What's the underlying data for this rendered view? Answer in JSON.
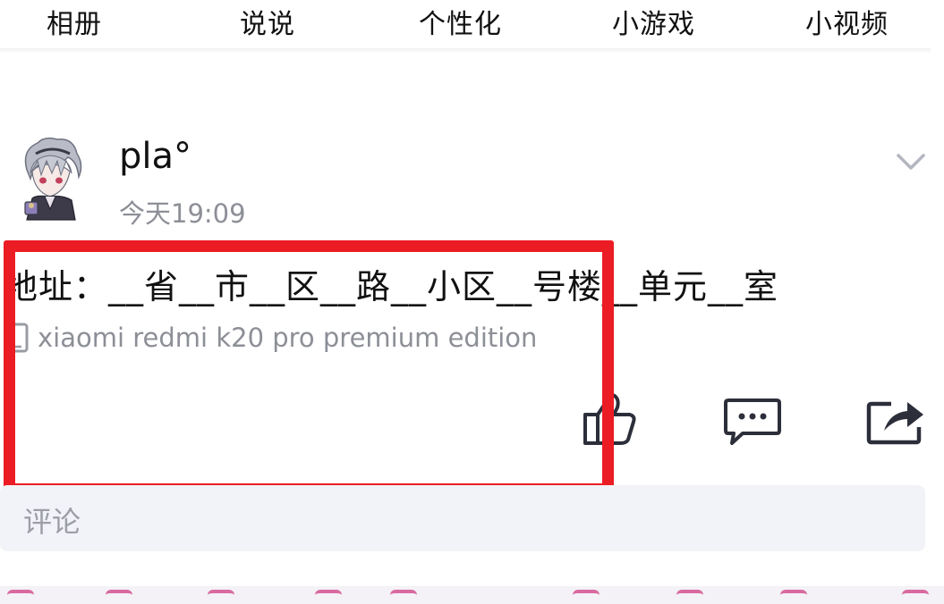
{
  "nav": {
    "items": [
      {
        "label": "相册"
      },
      {
        "label": "说说"
      },
      {
        "label": "个性化"
      },
      {
        "label": "小游戏"
      },
      {
        "label": "小视频"
      }
    ]
  },
  "post": {
    "username": "pla°",
    "time": "今天19:09",
    "text": "地址：__省__市__区__路__小区__号楼__单元__室",
    "device": "xiaomi redmi k20 pro premium edition",
    "comment_placeholder": "评论"
  },
  "colors": {
    "highlight": "#ec1c24",
    "muted_text": "#8d8f97",
    "comment_bg": "#f2f3f8",
    "icon": "#2c2e3a"
  },
  "icons": {
    "more": "chevron-down-icon",
    "like": "thumbs-up-icon",
    "comment": "comment-bubble-icon",
    "share": "share-icon",
    "device": "phone-icon"
  }
}
